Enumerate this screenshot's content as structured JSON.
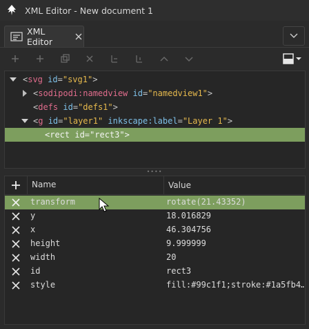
{
  "window": {
    "title": "XML Editor - New document 1"
  },
  "tab": {
    "label": "XML Editor"
  },
  "tree": {
    "rows": [
      {
        "tag": "svg",
        "attrs": [
          {
            "name": "id",
            "value": "\"svg1\""
          }
        ],
        "close": ">"
      },
      {
        "tag": "sodipodi:namedview",
        "attrs": [
          {
            "name": "id",
            "value": "\"namedview1\""
          }
        ],
        "close": ">"
      },
      {
        "tag": "defs",
        "attrs": [
          {
            "name": "id",
            "value": "\"defs1\""
          }
        ],
        "close": ">"
      },
      {
        "tag": "g",
        "attrs": [
          {
            "name": "id",
            "value": "\"layer1\""
          },
          {
            "name": "inkscape:label",
            "value": "\"Layer 1\""
          }
        ],
        "close": ">"
      },
      {
        "text": "<rect id=\"rect3\">"
      }
    ]
  },
  "attributes": {
    "header": {
      "name": "Name",
      "value": "Value"
    },
    "rows": [
      {
        "name": "transform",
        "value": "rotate(21.43352)"
      },
      {
        "name": "y",
        "value": "18.016829"
      },
      {
        "name": "x",
        "value": "46.304756"
      },
      {
        "name": "height",
        "value": "9.999999"
      },
      {
        "name": "width",
        "value": "20"
      },
      {
        "name": "id",
        "value": "rect3"
      },
      {
        "name": "style",
        "value": "fill:#99c1f1;stroke:#1a5fb4…"
      }
    ]
  },
  "colors": {
    "selection": "#7d9e5e",
    "tag": "#e06c8c",
    "attr": "#7ec0e8",
    "value": "#e6b94d"
  }
}
